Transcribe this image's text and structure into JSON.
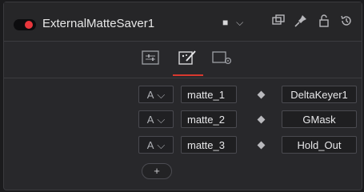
{
  "header": {
    "title": "ExternalMatteSaver1",
    "dropdown_symbol": "■",
    "chevron": "⌵",
    "icons": [
      "pip-icon",
      "pin-icon",
      "lock-icon",
      "reset-icon"
    ]
  },
  "tabs": [
    {
      "name": "controls",
      "icon": "sliders-icon",
      "active": false
    },
    {
      "name": "settings",
      "icon": "edit-wand-icon",
      "active": true
    },
    {
      "name": "settings-gear",
      "icon": "settings-icon",
      "active": false
    }
  ],
  "rows": [
    {
      "mode": "A",
      "matte": "matte_1",
      "source": "DeltaKeyer1"
    },
    {
      "mode": "A",
      "matte": "matte_2",
      "source": "GMask"
    },
    {
      "mode": "A",
      "matte": "matte_3",
      "source": "Hold_Out"
    }
  ],
  "add_button": "+",
  "colors": {
    "accent": "#d8392f",
    "record": "#e8363c",
    "panel": "#28282b"
  }
}
